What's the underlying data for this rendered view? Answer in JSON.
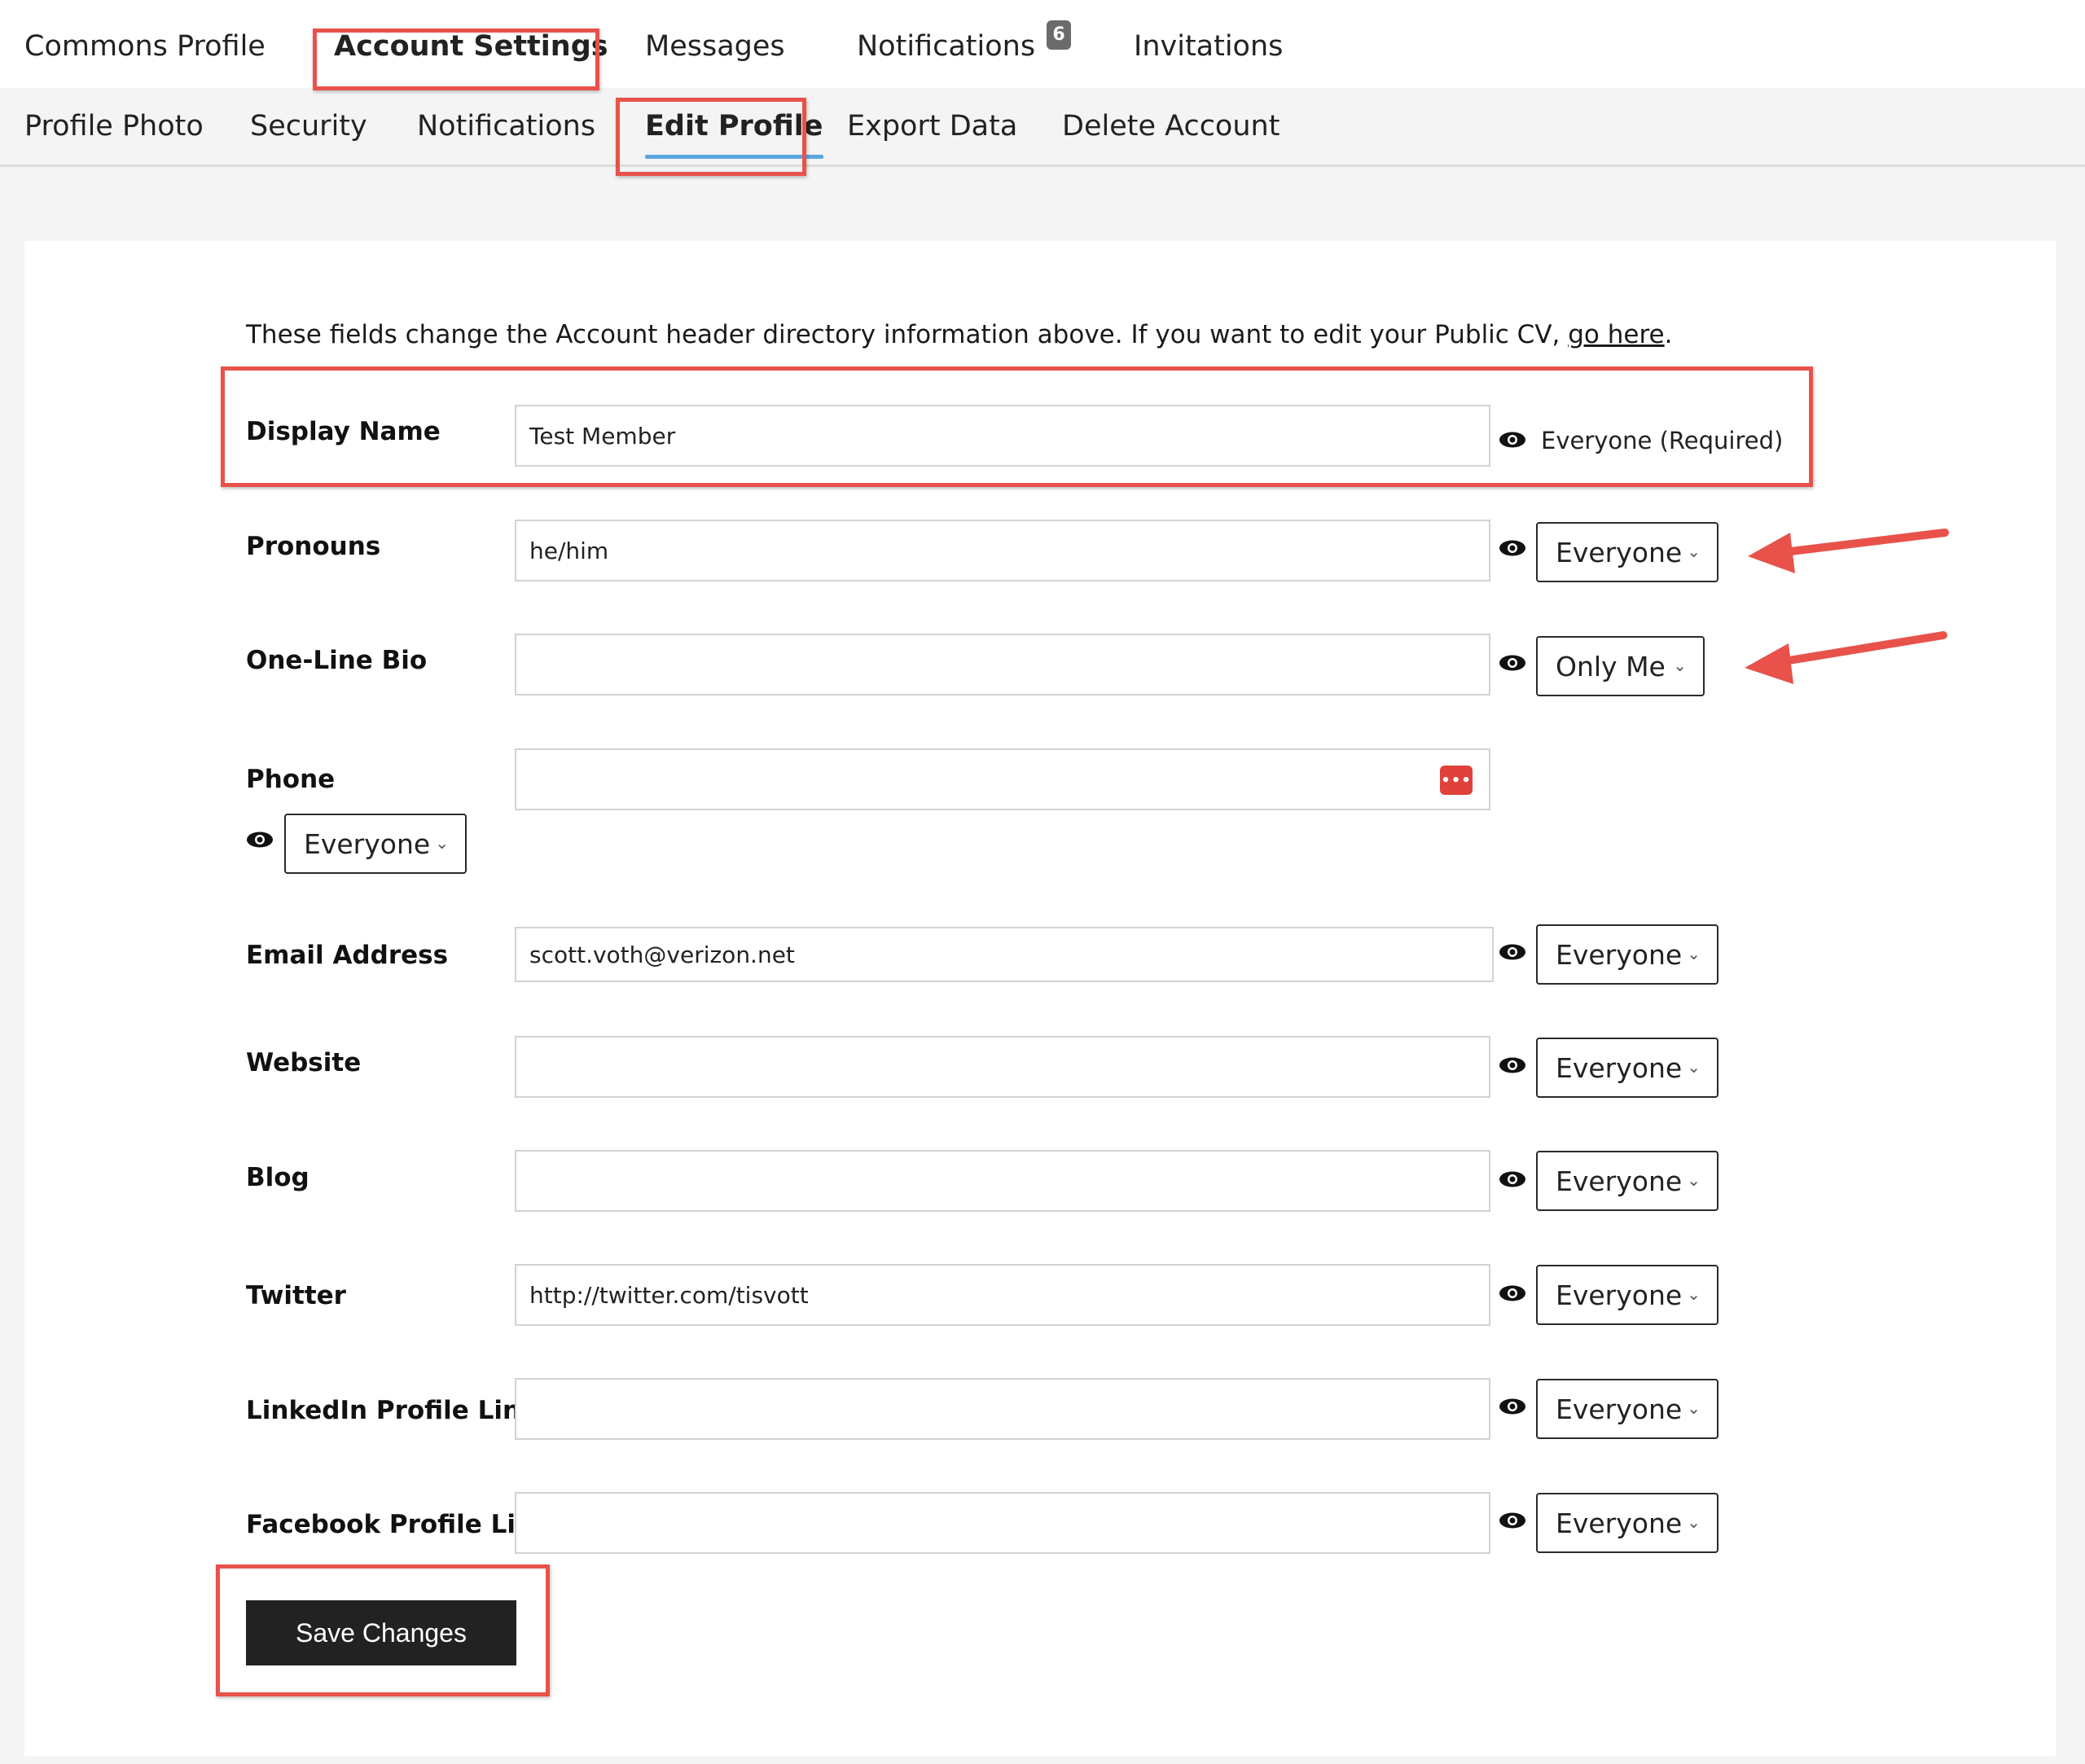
{
  "top_nav": {
    "items": [
      {
        "label": "Commons Profile"
      },
      {
        "label": "Account Settings"
      },
      {
        "label": "Messages"
      },
      {
        "label": "Notifications",
        "badge": "6"
      },
      {
        "label": "Invitations"
      }
    ]
  },
  "sub_nav": {
    "items": [
      {
        "label": "Profile Photo"
      },
      {
        "label": "Security"
      },
      {
        "label": "Notifications"
      },
      {
        "label": "Edit Profile"
      },
      {
        "label": "Export Data"
      },
      {
        "label": "Delete Account"
      }
    ]
  },
  "intro": {
    "text": "These fields change the Account header directory information above. If you want to edit your Public CV, ",
    "link": "go here",
    "end": "."
  },
  "fields": [
    {
      "label": "Display Name",
      "value": "Test Member",
      "visibility": "Everyone (Required)"
    },
    {
      "label": "Pronouns",
      "value": "he/him",
      "visibility": "Everyone"
    },
    {
      "label": "One-Line Bio",
      "value": "",
      "visibility": "Only Me"
    },
    {
      "label": "Phone",
      "value": "",
      "visibility": "Everyone"
    },
    {
      "label": "Email Address",
      "value": "scott.voth@verizon.net",
      "visibility": "Everyone"
    },
    {
      "label": "Website",
      "value": "",
      "visibility": "Everyone"
    },
    {
      "label": "Blog",
      "value": "",
      "visibility": "Everyone"
    },
    {
      "label": "Twitter",
      "value": "http://twitter.com/tisvott",
      "visibility": "Everyone"
    },
    {
      "label": "LinkedIn Profile Link",
      "value": "",
      "visibility": "Everyone"
    },
    {
      "label": "Facebook Profile Link",
      "value": "",
      "visibility": "Everyone"
    }
  ],
  "save_label": "Save Changes",
  "colors": {
    "annotation": "#e8524a",
    "active_underline": "#5aa7e0",
    "button": "#222222",
    "password_icon": "#e0413b"
  }
}
